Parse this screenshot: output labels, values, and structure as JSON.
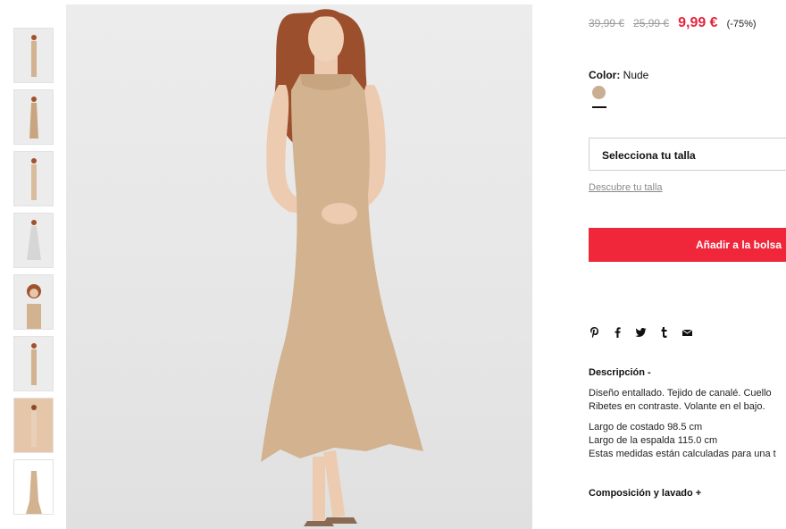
{
  "product": {
    "price_original": "39,99 €",
    "price_previous": "25,99 €",
    "price_sale": "9,99 €",
    "discount": "(-75%)",
    "color_label": "Color:",
    "color_value": "Nude",
    "swatch_color": "#c9ae91",
    "size_placeholder": "Selecciona tu talla",
    "size_guide_link": "Descubre tu talla",
    "add_to_bag": "Añadir a la bolsa",
    "accent_color": "#f0263a",
    "sale_color": "#e8243c"
  },
  "share_icons": [
    "pinterest-icon",
    "facebook-icon",
    "twitter-icon",
    "tumblr-icon",
    "mail-icon"
  ],
  "description": {
    "heading": "Descripción -",
    "text_line1": "Diseño entallado. Tejido de canalé. Cuello",
    "text_line2": "Ribetes en contraste. Volante en el bajo.",
    "measure_line1": "Largo de costado 98.5 cm",
    "measure_line2": "Largo de la espalda 115.0 cm",
    "measure_line3": "Estas medidas están calculadas para una t"
  },
  "composition": {
    "heading": "Composición y lavado +"
  },
  "gallery": {
    "thumb_count": 8,
    "dress_color": "#d2b28f",
    "hair_color": "#a0522d"
  }
}
